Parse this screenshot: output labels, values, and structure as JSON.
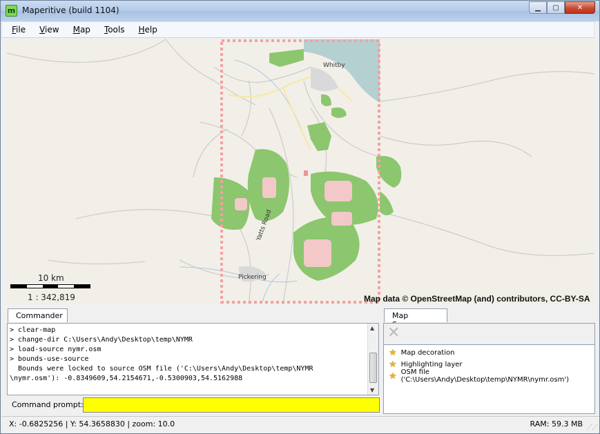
{
  "window": {
    "title": "Maperitive (build 1104)",
    "app_icon": "m"
  },
  "menu": [
    "File",
    "View",
    "Map",
    "Tools",
    "Help"
  ],
  "map": {
    "places": [
      "Whitby",
      "Yatts Road",
      "Pickering"
    ],
    "scale_label": "10 km",
    "scale_ratio": "1 : 342,819",
    "attribution": "Map data © OpenStreetMap (and) contributors, CC-BY-SA",
    "colors": {
      "background": "#f2efe9",
      "forest": "#8cc66e",
      "sea": "#b5d0d0",
      "bounds": "#f3a1a1",
      "residential": "#f2c8c8",
      "road": "#c5c5c5"
    }
  },
  "commander": {
    "tab_label": "Commander",
    "lines": [
      "> clear-map",
      "> change-dir C:\\Users\\Andy\\Desktop\\temp\\NYMR",
      "> load-source nymr.osm",
      "> bounds-use-source",
      "  Bounds were locked to source OSM file ('C:\\Users\\Andy\\Desktop\\temp\\NYMR",
      "\\nymr.osm'): -0.8349609,54.2154671,-0.5300903,54.5162988"
    ],
    "prompt_label": "Command prompt:",
    "prompt_value": ""
  },
  "map_sources": {
    "tab_label": "Map Sources",
    "items": [
      {
        "label": "Map decoration",
        "icon": "star-icon"
      },
      {
        "label": "Highlighting layer",
        "icon": "star-icon"
      },
      {
        "label": "OSM file ('C:\\Users\\Andy\\Desktop\\temp\\NYMR\\nymr.osm')",
        "icon": "star-icon"
      }
    ]
  },
  "status": {
    "coords": "X: -0.6825256 | Y: 54.3658830  | zoom: 10.0",
    "ram": "RAM: 59.3 MB"
  }
}
